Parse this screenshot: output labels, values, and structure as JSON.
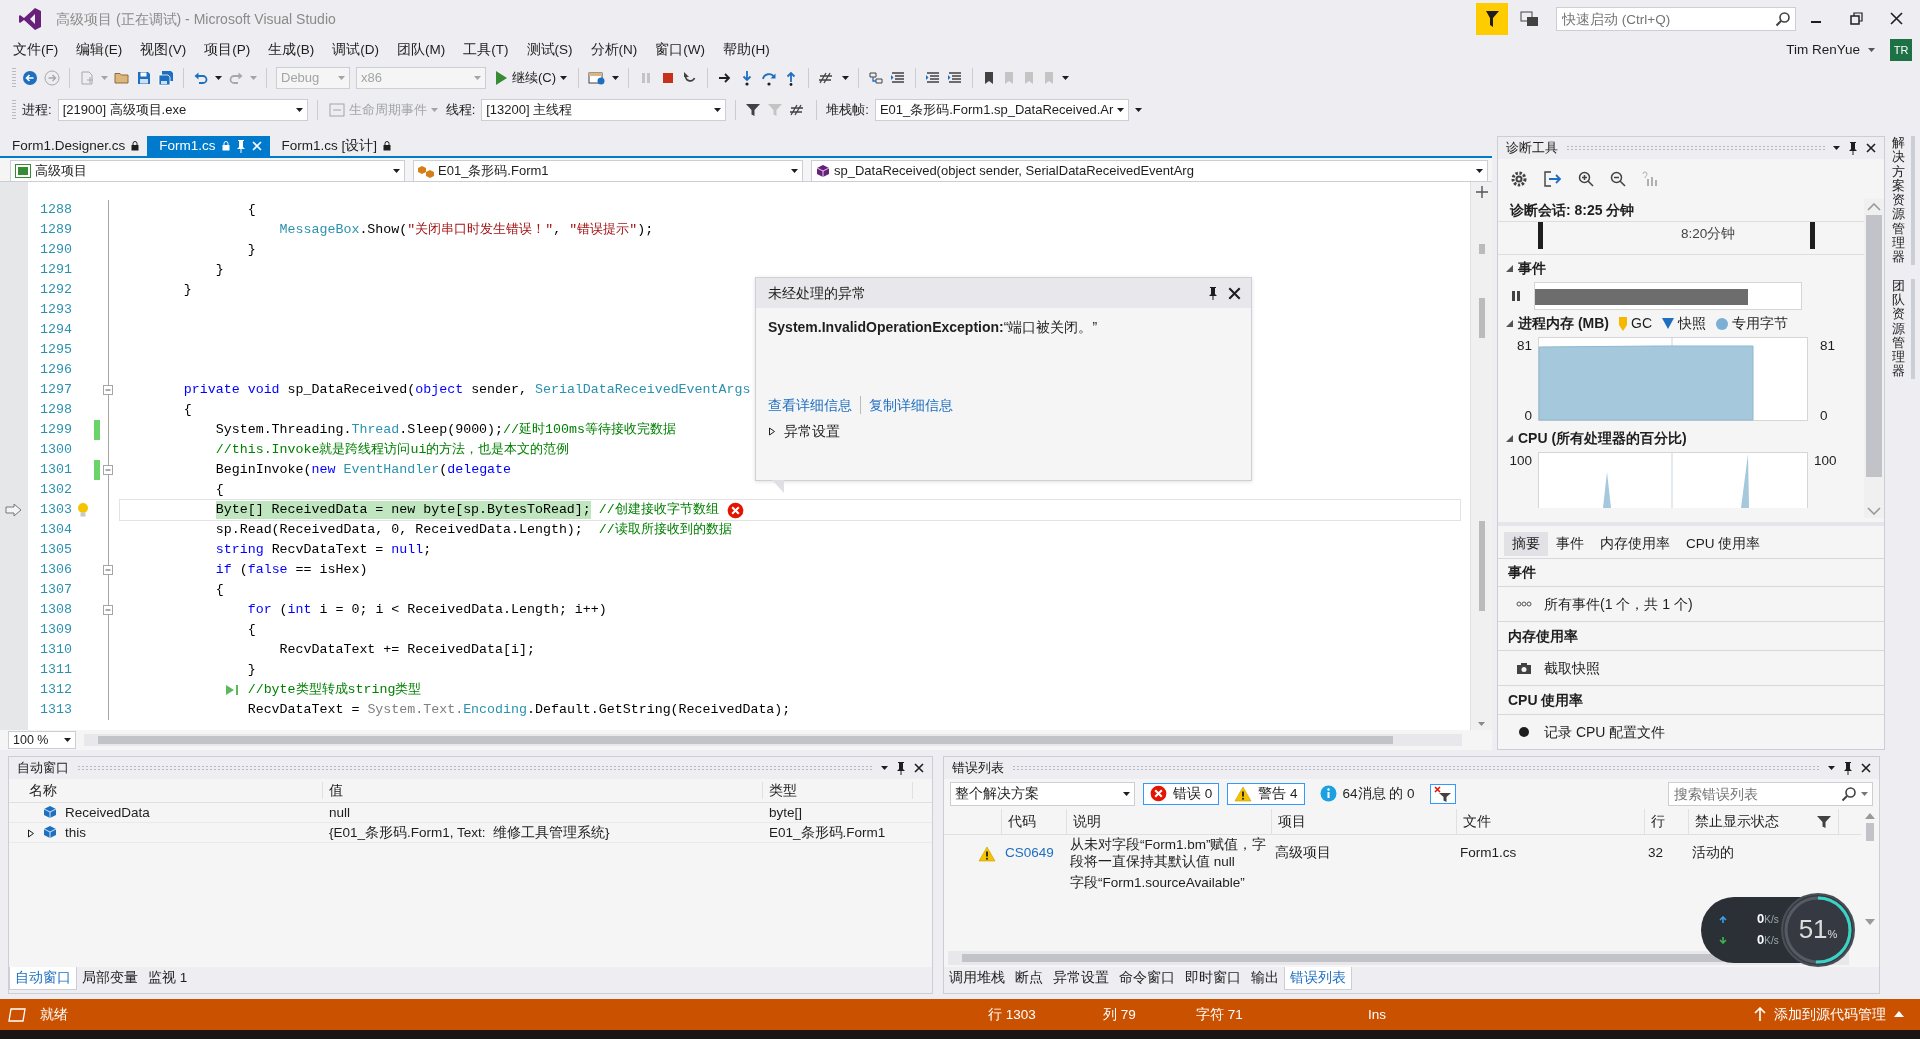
{
  "window": {
    "title": "高级项目 (正在调试) - Microsoft Visual Studio",
    "quick_launch": {
      "placeholder": "快速启动 (Ctrl+Q)"
    },
    "user": {
      "name": "Tim RenYue",
      "initials": "TR"
    }
  },
  "menu": [
    "文件(F)",
    "编辑(E)",
    "视图(V)",
    "项目(P)",
    "生成(B)",
    "调试(D)",
    "团队(M)",
    "工具(T)",
    "测试(S)",
    "分析(N)",
    "窗口(W)",
    "帮助(H)"
  ],
  "toolbar": {
    "configuration": "Debug",
    "platform": {
      "label": "x86",
      "disabled": true
    },
    "continue": "继续(C)"
  },
  "debug_location": {
    "process_label": "进程:",
    "process": "[21900] 高级项目.exe",
    "lifecycle": {
      "label": "生命周期事件",
      "disabled": true
    },
    "thread_label": "线程:",
    "thread": "[13200] 主线程",
    "stack_label": "堆栈帧:",
    "stack_frame": "E01_条形码.Form1.sp_DataReceived.Ar"
  },
  "document_tabs": [
    {
      "label": "Form1.Designer.cs",
      "selected": false
    },
    {
      "label": "Form1.cs",
      "selected": true
    },
    {
      "label": "Form1.cs [设计]",
      "selected": false
    }
  ],
  "editor": {
    "nav": {
      "project": "高级项目",
      "type": "E01_条形码.Form1",
      "member": "sp_DataReceived(object sender, SerialDataReceivedEventArg"
    },
    "lines": [
      {
        "number": "1288",
        "changed": false,
        "fold": false,
        "current": false,
        "segments": [
          {
            "kind": "plain",
            "text": "                {"
          }
        ]
      },
      {
        "number": "1289",
        "changed": false,
        "fold": false,
        "current": false,
        "segments": [
          {
            "kind": "type",
            "text": "                    MessageBox"
          },
          {
            "kind": "plain",
            "text": ".Show("
          },
          {
            "kind": "string",
            "text": "\"关闭串口时发生错误！\""
          },
          {
            "kind": "plain",
            "text": ", "
          },
          {
            "kind": "string",
            "text": "\"错误提示\""
          },
          {
            "kind": "plain",
            "text": ");"
          }
        ]
      },
      {
        "number": "1290",
        "changed": false,
        "fold": false,
        "current": false,
        "segments": [
          {
            "kind": "plain",
            "text": "                }"
          }
        ]
      },
      {
        "number": "1291",
        "changed": false,
        "fold": false,
        "current": false,
        "segments": [
          {
            "kind": "plain",
            "text": "            }"
          }
        ]
      },
      {
        "number": "1292",
        "changed": false,
        "fold": false,
        "current": false,
        "segments": [
          {
            "kind": "plain",
            "text": "        }"
          }
        ]
      },
      {
        "number": "1293",
        "changed": false,
        "fold": false,
        "current": false
      },
      {
        "number": "1294",
        "changed": false,
        "fold": false,
        "current": false
      },
      {
        "number": "1295",
        "changed": false,
        "fold": false,
        "current": false
      },
      {
        "number": "1296",
        "changed": false,
        "fold": false,
        "current": false
      },
      {
        "number": "1297",
        "changed": false,
        "fold": true,
        "current": false,
        "segments": [
          {
            "kind": "keyword",
            "text": "        private void"
          },
          {
            "kind": "plain",
            "text": " sp_DataReceived("
          },
          {
            "kind": "keyword",
            "text": "object"
          },
          {
            "kind": "plain",
            "text": " sender, "
          },
          {
            "kind": "type",
            "text": "SerialDataReceivedEventArgs"
          }
        ]
      },
      {
        "number": "1298",
        "changed": false,
        "fold": false,
        "current": false,
        "segments": [
          {
            "kind": "plain",
            "text": "        {"
          }
        ]
      },
      {
        "number": "1299",
        "changed": true,
        "fold": false,
        "current": false,
        "segments": [
          {
            "kind": "plain",
            "text": "            System.Threading."
          },
          {
            "kind": "type",
            "text": "Thread"
          },
          {
            "kind": "plain",
            "text": ".Sleep(9000);"
          },
          {
            "kind": "comment",
            "text": "//延时100ms等待接收完数据"
          }
        ]
      },
      {
        "number": "1300",
        "changed": false,
        "fold": false,
        "current": false,
        "segments": [
          {
            "kind": "comment",
            "text": "            //this.Invoke就是跨线程访问ui的方法，也是本文的范例"
          }
        ]
      },
      {
        "number": "1301",
        "changed": true,
        "fold": true,
        "current": false,
        "segments": [
          {
            "kind": "plain",
            "text": "            BeginInvoke("
          },
          {
            "kind": "keyword",
            "text": "new"
          },
          {
            "kind": "type",
            "text": " EventHandler"
          },
          {
            "kind": "plain",
            "text": "("
          },
          {
            "kind": "keyword",
            "text": "delegate"
          }
        ]
      },
      {
        "number": "1302",
        "changed": false,
        "fold": false,
        "current": false,
        "segments": [
          {
            "kind": "plain",
            "text": "            {"
          }
        ]
      },
      {
        "number": "1303",
        "changed": false,
        "fold": false,
        "current": true,
        "segments": [
          {
            "kind": "highlight",
            "text": "            Byte[] ReceivedData = new byte[sp.BytesToRead];"
          },
          {
            "kind": "comment",
            "text": " //创建接收字节数组"
          }
        ]
      },
      {
        "number": "1304",
        "changed": false,
        "fold": false,
        "current": false,
        "segments": [
          {
            "kind": "plain",
            "text": "            sp.Read(ReceivedData, 0, ReceivedData.Length);  "
          },
          {
            "kind": "comment",
            "text": "//读取所接收到的数据"
          }
        ]
      },
      {
        "number": "1305",
        "changed": false,
        "fold": false,
        "current": false,
        "segments": [
          {
            "kind": "keyword",
            "text": "            string"
          },
          {
            "kind": "plain",
            "text": " RecvDataText = "
          },
          {
            "kind": "keyword",
            "text": "null"
          },
          {
            "kind": "plain",
            "text": ";"
          }
        ]
      },
      {
        "number": "1306",
        "changed": false,
        "fold": true,
        "current": false,
        "segments": [
          {
            "kind": "keyword",
            "text": "            if"
          },
          {
            "kind": "plain",
            "text": " ("
          },
          {
            "kind": "keyword",
            "text": "false"
          },
          {
            "kind": "plain",
            "text": " == isHex)"
          }
        ]
      },
      {
        "number": "1307",
        "changed": false,
        "fold": false,
        "current": false,
        "segments": [
          {
            "kind": "plain",
            "text": "            {"
          }
        ]
      },
      {
        "number": "1308",
        "changed": false,
        "fold": true,
        "current": false,
        "segments": [
          {
            "kind": "keyword",
            "text": "                for"
          },
          {
            "kind": "plain",
            "text": " ("
          },
          {
            "kind": "keyword",
            "text": "int"
          },
          {
            "kind": "plain",
            "text": " i = 0; i < ReceivedData.Length; i++)"
          }
        ]
      },
      {
        "number": "1309",
        "changed": false,
        "fold": false,
        "current": false,
        "segments": [
          {
            "kind": "plain",
            "text": "                {"
          }
        ]
      },
      {
        "number": "1310",
        "changed": false,
        "fold": false,
        "current": false,
        "segments": [
          {
            "kind": "plain",
            "text": "                    RecvDataText += ReceivedData[i];"
          }
        ]
      },
      {
        "number": "1311",
        "changed": false,
        "fold": false,
        "current": false,
        "segments": [
          {
            "kind": "plain",
            "text": "                }"
          }
        ]
      },
      {
        "number": "1312",
        "changed": false,
        "fold": false,
        "current": false,
        "run_to_click": true,
        "segments": [
          {
            "kind": "comment",
            "text": "                //byte类型转成string类型"
          }
        ]
      },
      {
        "number": "1313",
        "changed": false,
        "fold": false,
        "current": false,
        "segments": [
          {
            "kind": "plain",
            "text": "                RecvDataText = "
          },
          {
            "kind": "dim",
            "text": "System.Text."
          },
          {
            "kind": "type",
            "text": "Encoding"
          },
          {
            "kind": "plain",
            "text": ".Default.GetString(ReceivedData);"
          }
        ]
      }
    ],
    "zoom": "100 %"
  },
  "exception": {
    "title": "未经处理的异常",
    "message": "**System.InvalidOperationException:**“端口被关闭。”",
    "links": [
      "查看详细信息",
      "复制详细信息"
    ],
    "settings": {
      "label": "异常设置",
      "expanded": false
    }
  },
  "diagnostics": {
    "title": "诊断工具",
    "session": "诊断会话: 8:25 分钟",
    "timeline_label": "8:20分钟",
    "sections": [
      {
        "kind": "events",
        "title": "事件",
        "expanded": true
      },
      {
        "kind": "memory",
        "title": "进程内存 (MB)",
        "expanded": true,
        "legend": [
          {
            "kind": "gc",
            "label": "GC"
          },
          {
            "kind": "snapshot",
            "label": "快照"
          },
          {
            "kind": "bytes",
            "label": "专用字节"
          }
        ],
        "left_labels": [
          "81",
          "0"
        ],
        "right_labels": [
          "81",
          "0"
        ]
      },
      {
        "kind": "cpu",
        "title": "CPU (所有处理器的百分比)",
        "expanded": true,
        "left_labels": [
          "100"
        ],
        "right_labels": [
          "100"
        ]
      }
    ],
    "tabs": [
      {
        "label": "摘要",
        "selected": true
      },
      {
        "label": "事件",
        "selected": false
      },
      {
        "label": "内存使用率",
        "selected": false
      },
      {
        "label": "CPU 使用率",
        "selected": false
      }
    ],
    "summary": [
      {
        "kind": "events",
        "heading": "事件",
        "item": "所有事件(1 个，共 1 个)"
      },
      {
        "kind": "memory",
        "heading": "内存使用率",
        "item": "截取快照"
      },
      {
        "kind": "cpu",
        "heading": "CPU 使用率",
        "item": "记录 CPU 配置文件"
      }
    ]
  },
  "side_tabs": [
    "解决方案资源管理器",
    "团队资源管理器"
  ],
  "autos": {
    "title": "自动窗口",
    "columns": [
      "名称",
      "值",
      "类型"
    ],
    "rows": [
      {
        "name": "ReceivedData",
        "value": "null",
        "type": "byte[]",
        "expandable": false
      },
      {
        "name": "this",
        "value": "{E01_条形码.Form1, Text:  维修工具管理系统}",
        "type": "E01_条形码.Form1",
        "expandable": true
      }
    ],
    "tabs": [
      {
        "label": "自动窗口",
        "selected": true
      },
      {
        "label": "局部变量",
        "selected": false
      },
      {
        "label": "监视 1",
        "selected": false
      }
    ]
  },
  "error_list": {
    "title": "错误列表",
    "scope": "整个解决方案",
    "filters": [
      {
        "kind": "error",
        "label": "错误 0",
        "selected": true
      },
      {
        "kind": "warning",
        "label": "警告 4",
        "selected": true
      },
      {
        "kind": "message",
        "label": "64消息 的 0",
        "selected": false
      }
    ],
    "search": {
      "placeholder": "搜索错误列表"
    },
    "columns": [
      "代码",
      "说明",
      "项目",
      "文件",
      "行",
      "禁止显示状态"
    ],
    "rows": [
      {
        "kind": "warning",
        "code": "CS0649",
        "description": "从未对字段“Form1.bm”赋值，字段将一直保持其默认值 null",
        "project": "高级项目",
        "file": "Form1.cs",
        "line": "32",
        "state": "活动的"
      },
      {
        "description": "字段“Form1.sourceAvailable”"
      }
    ],
    "tabs": [
      {
        "label": "调用堆栈",
        "selected": false
      },
      {
        "label": "断点",
        "selected": false
      },
      {
        "label": "异常设置",
        "selected": false
      },
      {
        "label": "命令窗口",
        "selected": false
      },
      {
        "label": "即时窗口",
        "selected": false
      },
      {
        "label": "输出",
        "selected": false
      },
      {
        "label": "错误列表",
        "selected": true
      }
    ]
  },
  "network_widget": {
    "upload": {
      "value": "0",
      "unit": "K/s"
    },
    "download": {
      "value": "0",
      "unit": "K/s"
    },
    "percent": {
      "value": "51",
      "unit": "%"
    },
    "level": 0.51
  },
  "status_bar": {
    "message": "就绪",
    "line": "行 1303",
    "column": "列 79",
    "char": "字符 71",
    "mode": "Ins",
    "source_control": "添加到源代码管理"
  }
}
